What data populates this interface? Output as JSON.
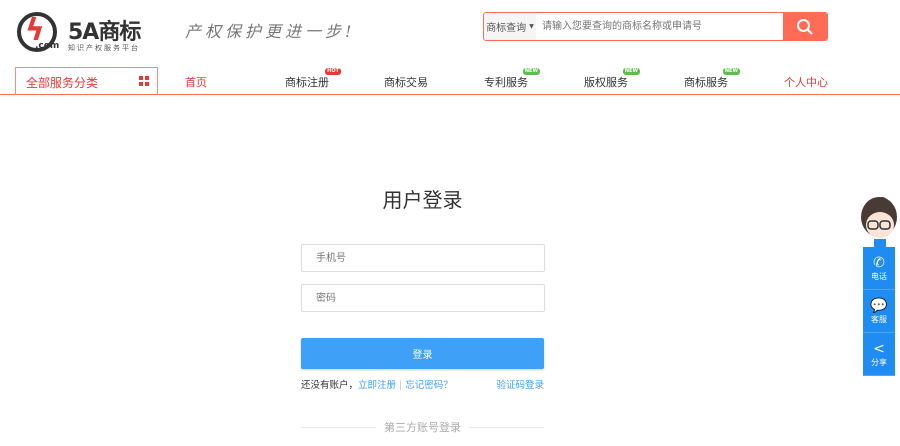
{
  "header": {
    "logo_text": "5A商标",
    "logo_domain": ".com",
    "logo_sub": "知识产权服务平台",
    "slogan": "产权保护更进一步!"
  },
  "search": {
    "type_label": "商标查询",
    "placeholder": "请输入您要查询的商标名称或申请号"
  },
  "nav": {
    "category_label": "全部服务分类",
    "items": [
      {
        "label": "首页"
      },
      {
        "label": "商标注册",
        "badge": "HOT"
      },
      {
        "label": "商标交易"
      },
      {
        "label": "专利服务",
        "badge": "NEW"
      },
      {
        "label": "版权服务",
        "badge": "NEW"
      },
      {
        "label": "商标服务",
        "badge": "NEW"
      },
      {
        "label": "个人中心"
      }
    ]
  },
  "login": {
    "title": "用户登录",
    "phone_placeholder": "手机号",
    "password_placeholder": "密码",
    "submit": "登录",
    "no_account": "还没有账户，",
    "register": "立即注册",
    "forgot": "忘记密码？",
    "sms_login": "验证码登录",
    "third_party": "第三方账号登录"
  },
  "side": {
    "items": [
      {
        "label": "电话"
      },
      {
        "label": "客服"
      },
      {
        "label": "分享"
      }
    ]
  },
  "colors": {
    "brand": "#ff6b55",
    "primary": "#3ea0f7",
    "side": "#1e8cf0"
  }
}
